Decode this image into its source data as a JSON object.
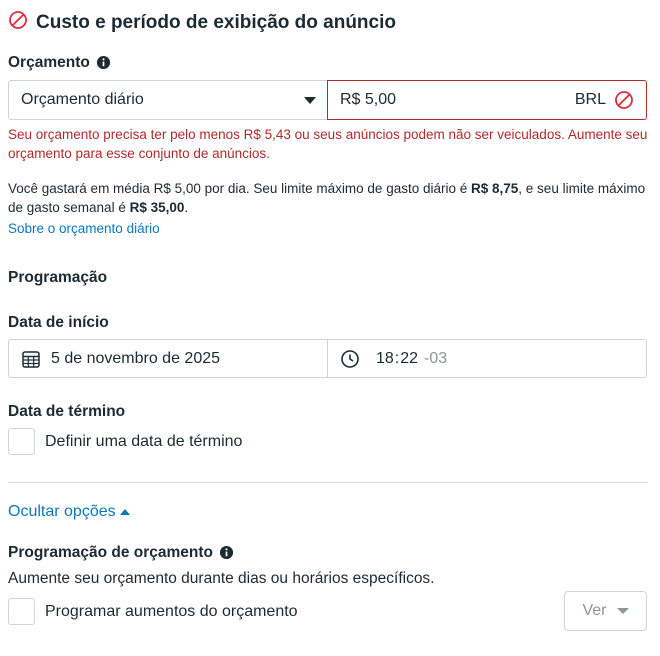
{
  "section": {
    "title": "Custo e período de exibição do anúncio",
    "icon": "prohibited-circle-icon",
    "icon_color": "#e02d3c"
  },
  "budget": {
    "label": "Orçamento",
    "type_select_value": "Orçamento diário",
    "amount_value": "R$ 5,00",
    "currency": "BRL",
    "error_text": "Seu orçamento precisa ter pelo menos R$ 5,43 ou seus anúncios podem não ser veiculados. Aumente seu orçamento para esse conjunto de anúncios.",
    "info_part1": "Você gastará em média R$ 5,00 por dia. Seu limite máximo de gasto diário é ",
    "info_bold1": "R$ 8,75",
    "info_part2": ", e seu limite máximo de gasto semanal é ",
    "info_bold2": "R$ 35,00",
    "info_part3": ".",
    "link_text": "Sobre o orçamento diário"
  },
  "schedule": {
    "heading": "Programação",
    "start_label": "Data de início",
    "start_date": "5 de novembro de 2025",
    "start_hour": "18",
    "time_sep": ":",
    "start_minute": "22",
    "timezone": "-03",
    "end_label": "Data de término",
    "end_checkbox_label": "Definir uma data de término"
  },
  "options": {
    "toggle_label": "Ocultar opções",
    "budget_schedule_label": "Programação de orçamento",
    "budget_schedule_desc": "Aumente seu orçamento durante dias ou horários específicos.",
    "budget_schedule_checkbox_label": "Programar aumentos do orçamento",
    "ver_button": "Ver"
  },
  "colors": {
    "error": "#b22a2a",
    "link": "#0a78be",
    "text": "#1c2b33"
  }
}
